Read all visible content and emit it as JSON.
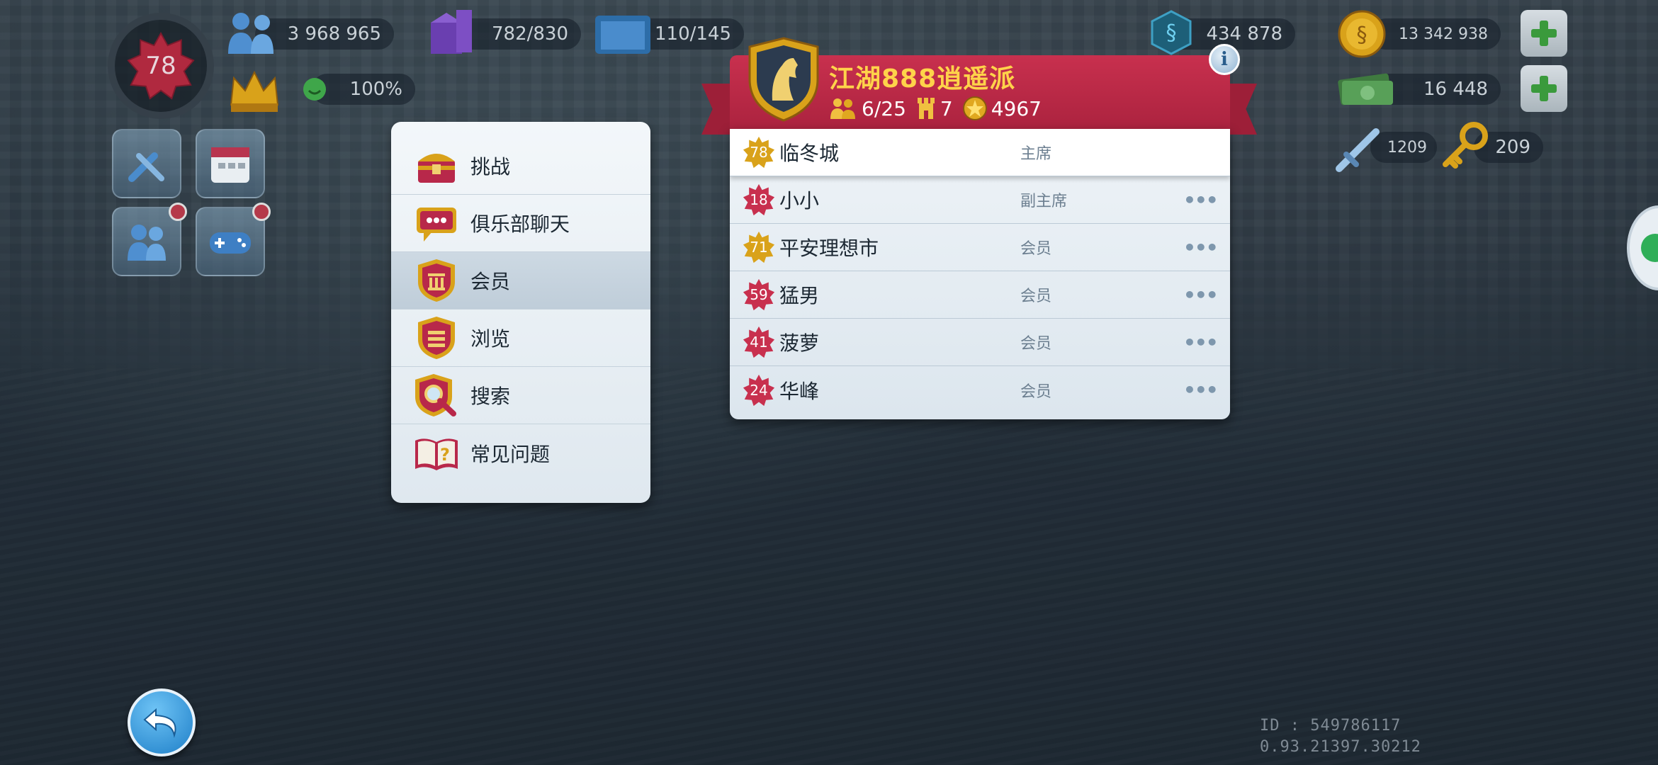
{
  "hud": {
    "level": "78",
    "population": "3 968 965",
    "storage": "782/830",
    "warehouse": "110/145",
    "happiness": "100%",
    "neosimoleons": "434 878",
    "simoleons": "13 342 938",
    "simcash": "16 448",
    "war_items": "1209",
    "keys": "209"
  },
  "menu": {
    "items": [
      {
        "label": "挑战",
        "icon": "treasure-chest-icon"
      },
      {
        "label": "俱乐部聊天",
        "icon": "chat-bubble-icon"
      },
      {
        "label": "会员",
        "icon": "members-shield-icon",
        "active": true
      },
      {
        "label": "浏览",
        "icon": "browse-shield-icon"
      },
      {
        "label": "搜索",
        "icon": "search-shield-icon"
      },
      {
        "label": "常见问题",
        "icon": "faq-book-icon"
      }
    ]
  },
  "club": {
    "name": "江湖888逍遥派",
    "members_count": "6/25",
    "towers": "7",
    "points": "4967"
  },
  "members": [
    {
      "level": "78",
      "name": "临冬城",
      "role": "主席",
      "more": false,
      "gold": true
    },
    {
      "level": "18",
      "name": "小小",
      "role": "副主席",
      "more": true,
      "gold": false
    },
    {
      "level": "71",
      "name": "平安理想市",
      "role": "会员",
      "more": true,
      "gold": true
    },
    {
      "level": "59",
      "name": "猛男",
      "role": "会员",
      "more": true,
      "gold": false
    },
    {
      "level": "41",
      "name": "菠萝",
      "role": "会员",
      "more": true,
      "gold": false
    },
    {
      "level": "24",
      "name": "华峰",
      "role": "会员",
      "more": true,
      "gold": false
    }
  ],
  "more_symbol": "•••",
  "info_symbol": "i",
  "footer": {
    "id_line": "ID : 549786117",
    "version_line": "0.93.21397.30212"
  },
  "colors": {
    "ribbon": "#b8284a",
    "club_name": "#ffd34a",
    "level_star_red": "#c8304e",
    "level_star_gold": "#d9a21a"
  }
}
